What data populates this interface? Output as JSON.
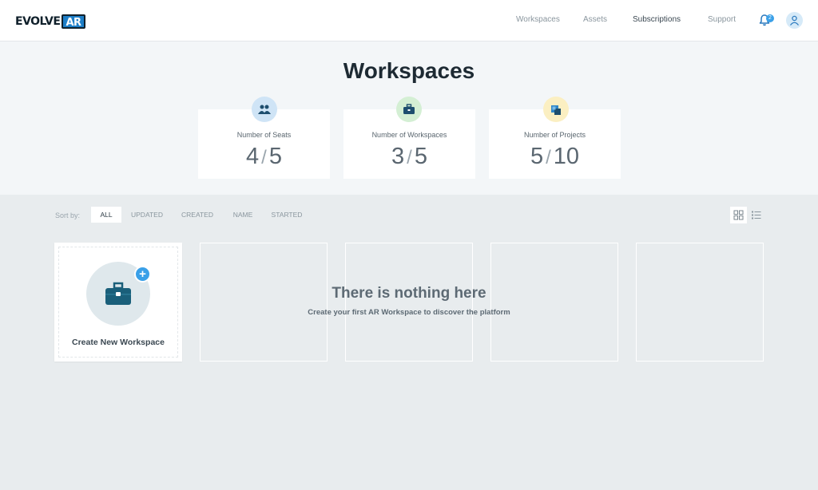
{
  "brand": {
    "logo_text": "EVOLVE",
    "logo_badge": "AR"
  },
  "nav": {
    "items": [
      {
        "label": "Workspaces"
      },
      {
        "label": "Assets"
      },
      {
        "label": "Subscriptions"
      },
      {
        "label": "Support"
      }
    ],
    "notifications_count": "2"
  },
  "page": {
    "title": "Workspaces"
  },
  "stats": [
    {
      "label": "Number of Seats",
      "used": "4",
      "total": "5",
      "icon": "users-icon"
    },
    {
      "label": "Number of Workspaces",
      "used": "3",
      "total": "5",
      "icon": "briefcase-icon"
    },
    {
      "label": "Number of Projects",
      "used": "5",
      "total": "10",
      "icon": "box-icon"
    }
  ],
  "sort": {
    "label": "Sort by:",
    "options": [
      {
        "label": "ALL",
        "selected": true
      },
      {
        "label": "UPDATED"
      },
      {
        "label": "CREATED"
      },
      {
        "label": "NAME"
      },
      {
        "label": "STARTED"
      }
    ],
    "view_mode": "grid"
  },
  "new_workspace": {
    "label": "Create New Workspace"
  },
  "empty_state": {
    "title": "There is nothing here",
    "subtitle": "Create your first AR Workspace to discover the platform"
  },
  "colors": {
    "accent": "#3aa0e8",
    "brand_dark": "#1a5f7a"
  }
}
